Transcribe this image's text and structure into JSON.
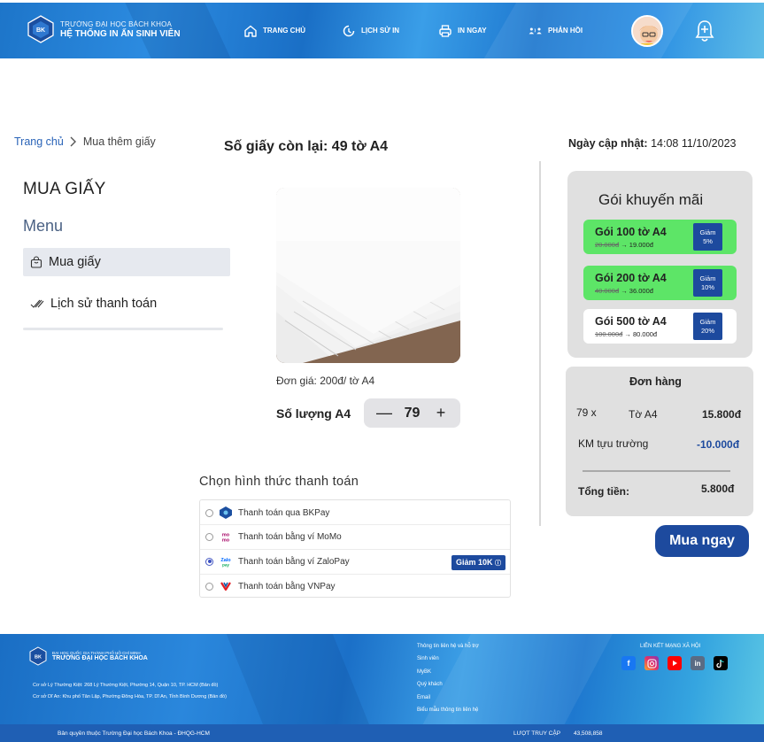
{
  "header": {
    "logo_line1": "TRƯỜNG ĐẠI HỌC BÁCH KHOA",
    "logo_line2": "HỆ THỐNG IN ẤN SINH VIÊN",
    "logo_badge": "BK",
    "nav": [
      {
        "label": "TRANG CHỦ",
        "icon": "home-icon"
      },
      {
        "label": "LỊCH SỬ IN",
        "icon": "history-icon"
      },
      {
        "label": "IN NGAY",
        "icon": "printer-icon"
      },
      {
        "label": "PHẢN HỒI",
        "icon": "feedback-icon"
      }
    ],
    "colors": {
      "primary": "#1d75c9",
      "accent": "#1d4a9e"
    }
  },
  "breadcrumb": {
    "home": "Trang chủ",
    "current": "Mua thêm giấy"
  },
  "remaining": "Số giấy còn lại: 49 tờ A4",
  "updated": {
    "label": "Ngày cập nhật:",
    "value": "14:08 11/10/2023"
  },
  "sidebar": {
    "title": "MUA GIẤY",
    "menu_title": "Menu",
    "items": [
      {
        "label": "Mua giấy",
        "icon": "bag-icon",
        "active": true
      },
      {
        "label": "Lịch sử thanh toán",
        "icon": "double-check-icon",
        "active": false
      }
    ]
  },
  "product": {
    "unit_price": "Đơn giá: 200đ/ tờ A4",
    "quantity_label": "Số lượng A4",
    "quantity": "79",
    "minus": "—",
    "plus": "+"
  },
  "payment": {
    "title": "Chọn hình thức thanh toán",
    "options": [
      {
        "label": "Thanh toán qua BKPay",
        "selected": false
      },
      {
        "label": "Thanh toán bằng ví MoMo",
        "selected": false
      },
      {
        "label": "Thanh toán bằng ví ZaloPay",
        "selected": true,
        "badge": "Giảm 10K"
      },
      {
        "label": "Thanh toán bằng VNPay",
        "selected": false
      }
    ]
  },
  "promo": {
    "title": "Gói khuyến mãi",
    "packages": [
      {
        "name": "Gói 100 tờ A4",
        "old_price": "20.000đ",
        "new_price": "→ 19.000đ",
        "off_label": "Giảm",
        "off_value": "5%",
        "color": "#5de567"
      },
      {
        "name": "Gói 200 tờ A4",
        "old_price": "40.000đ",
        "new_price": "→ 36.000đ",
        "off_label": "Giảm",
        "off_value": "10%",
        "color": "#5de567"
      },
      {
        "name": "Gói 500 tờ A4",
        "old_price": "100.000đ",
        "new_price": "→ 80.000đ",
        "off_label": "Giảm",
        "off_value": "20%",
        "color": "#ffffff"
      }
    ]
  },
  "order": {
    "title": "Đơn hàng",
    "qty": "79 x",
    "item": "Tờ A4",
    "item_total": "15.800đ",
    "promo_label": "KM tựu trường",
    "promo_value": "-10.000đ",
    "total_label": "Tổng tiền:",
    "total_value": "5.800đ"
  },
  "buy_button": "Mua ngay",
  "footer": {
    "logo_line1": "ĐẠI HỌC QUỐC GIA THÀNH PHỐ HỒ CHÍ MINH",
    "logo_line2": "TRƯỜNG ĐẠI HỌC BÁCH KHOA",
    "address1": "Cơ sở Lý Thường Kiệt: 268 Lý Thường Kiệt, Phường 14, Quận 10, TP. HCM (Bản đồ)",
    "address2": "Cơ sở Dĩ An: Khu phố Tân Lập, Phường Đông Hòa, TP. Dĩ An, Tỉnh Bình Dương (Bản đồ)",
    "links": [
      "Thông tin liên hệ và hỗ trợ",
      "Sinh viên",
      "MyBK",
      "Quý khách",
      "Email",
      "Biểu mẫu thông tin liên hệ"
    ],
    "social_title": "LIÊN KẾT MẠNG XÃ HỘI",
    "social": [
      "f",
      "ig",
      "yt",
      "in",
      "tt"
    ],
    "copyright": "Bản quyền thuộc Trường Đại học Bách Khoa - ĐHQG-HCM",
    "visits_label": "LƯỢT TRUY CẬP",
    "visits_value": "43,508,858"
  }
}
